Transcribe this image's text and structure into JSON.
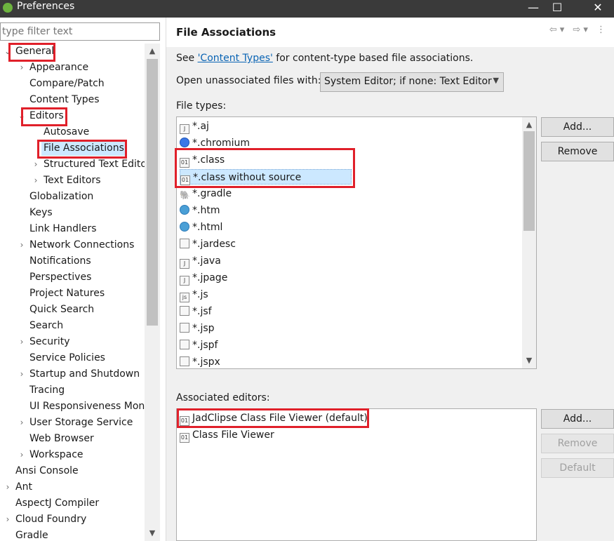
{
  "window": {
    "title": "Preferences",
    "minimize": "—",
    "maximize": "☐",
    "close": "✕"
  },
  "filter": {
    "placeholder": "type filter text"
  },
  "tree": [
    {
      "label": "General",
      "twisty": "open",
      "level": 0
    },
    {
      "label": "Appearance",
      "twisty": "closed",
      "level": 1
    },
    {
      "label": "Compare/Patch",
      "twisty": "none",
      "level": 1
    },
    {
      "label": "Content Types",
      "twisty": "none",
      "level": 1
    },
    {
      "label": "Editors",
      "twisty": "open",
      "level": 1
    },
    {
      "label": "Autosave",
      "twisty": "none",
      "level": 2
    },
    {
      "label": "File Associations",
      "twisty": "none",
      "level": 2,
      "selected": true
    },
    {
      "label": "Structured Text Edito",
      "twisty": "closed",
      "level": 2
    },
    {
      "label": "Text Editors",
      "twisty": "closed",
      "level": 2
    },
    {
      "label": "Globalization",
      "twisty": "none",
      "level": 1
    },
    {
      "label": "Keys",
      "twisty": "none",
      "level": 1
    },
    {
      "label": "Link Handlers",
      "twisty": "none",
      "level": 1
    },
    {
      "label": "Network Connections",
      "twisty": "closed",
      "level": 1
    },
    {
      "label": "Notifications",
      "twisty": "none",
      "level": 1
    },
    {
      "label": "Perspectives",
      "twisty": "none",
      "level": 1
    },
    {
      "label": "Project Natures",
      "twisty": "none",
      "level": 1
    },
    {
      "label": "Quick Search",
      "twisty": "none",
      "level": 1
    },
    {
      "label": "Search",
      "twisty": "none",
      "level": 1
    },
    {
      "label": "Security",
      "twisty": "closed",
      "level": 1
    },
    {
      "label": "Service Policies",
      "twisty": "none",
      "level": 1
    },
    {
      "label": "Startup and Shutdown",
      "twisty": "closed",
      "level": 1
    },
    {
      "label": "Tracing",
      "twisty": "none",
      "level": 1
    },
    {
      "label": "UI Responsiveness Moni",
      "twisty": "none",
      "level": 1
    },
    {
      "label": "User Storage Service",
      "twisty": "closed",
      "level": 1
    },
    {
      "label": "Web Browser",
      "twisty": "none",
      "level": 1
    },
    {
      "label": "Workspace",
      "twisty": "closed",
      "level": 1
    },
    {
      "label": "Ansi Console",
      "twisty": "none",
      "level": 0
    },
    {
      "label": "Ant",
      "twisty": "closed",
      "level": 0
    },
    {
      "label": "AspectJ Compiler",
      "twisty": "none",
      "level": 0
    },
    {
      "label": "Cloud Foundry",
      "twisty": "closed",
      "level": 0
    },
    {
      "label": "Gradle",
      "twisty": "none",
      "level": 0
    }
  ],
  "pane": {
    "title": "File Associations",
    "see_prefix": "See ",
    "see_link": "'Content Types'",
    "see_suffix": " for content-type based file associations.",
    "open_label": "Open unassociated files with:",
    "open_value": "System Editor; if none: Text Editor",
    "file_types_label": "File types:",
    "file_types": [
      {
        "name": "*.aj",
        "icon": "aj-file-icon"
      },
      {
        "name": "*.chromium",
        "icon": "chromium-icon"
      },
      {
        "name": "*.class",
        "icon": "class-file-icon"
      },
      {
        "name": "*.class without source",
        "icon": "class-file-icon",
        "selected": true
      },
      {
        "name": "*.gradle",
        "icon": "gradle-icon"
      },
      {
        "name": "*.htm",
        "icon": "globe-icon"
      },
      {
        "name": "*.html",
        "icon": "globe-icon"
      },
      {
        "name": "*.jardesc",
        "icon": "jardesc-icon"
      },
      {
        "name": "*.java",
        "icon": "java-file-icon"
      },
      {
        "name": "*.jpage",
        "icon": "jpage-icon"
      },
      {
        "name": "*.js",
        "icon": "js-file-icon"
      },
      {
        "name": "*.jsf",
        "icon": "text-file-icon"
      },
      {
        "name": "*.jsp",
        "icon": "text-file-icon"
      },
      {
        "name": "*.jspf",
        "icon": "text-file-icon"
      },
      {
        "name": "*.jspx",
        "icon": "text-file-icon"
      }
    ],
    "add_label": "Add...",
    "remove_label": "Remove",
    "assoc_label": "Associated editors:",
    "editors": [
      {
        "name": "JadClipse Class File Viewer (default)",
        "icon": "class-file-icon"
      },
      {
        "name": "Class File Viewer",
        "icon": "class-file-icon"
      }
    ],
    "add2_label": "Add...",
    "remove2_label": "Remove",
    "default_label": "Default"
  }
}
